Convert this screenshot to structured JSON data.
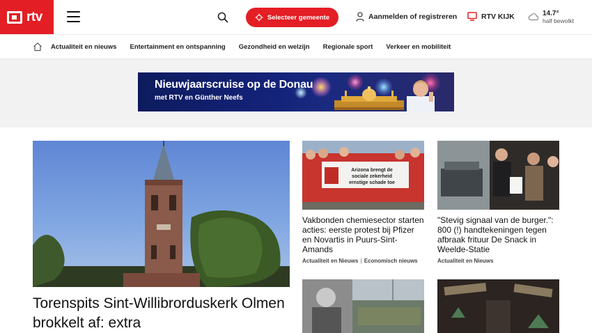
{
  "header": {
    "logo_text": "rtv",
    "select_button_label": "Selecteer gemeente",
    "login_label": "Aanmelden of registreren",
    "kijk_label": "RTV KIJK",
    "weather_temp": "14.7°",
    "weather_desc": "half bewolkt"
  },
  "subnav": {
    "items": [
      {
        "label": "Actualiteit en nieuws"
      },
      {
        "label": "Entertainment en ontspanning"
      },
      {
        "label": "Gezondheid en welzijn"
      },
      {
        "label": "Regionale sport"
      },
      {
        "label": "Verkeer en mobiliteit"
      }
    ]
  },
  "banner": {
    "title": "Nieuwjaarscruise op de Donau",
    "subtitle": "met RTV en Günther Neefs"
  },
  "main_article": {
    "title": "Torenspits Sint-Willibrorduskerk Olmen brokkelt af: extra"
  },
  "cards": [
    {
      "title": "Vakbonden chemiesector starten acties: eerste protest bij Pfizer en Novartis in Puurs-Sint-Amands",
      "tags": [
        "Actualiteit en Nieuws",
        "Economisch nieuws"
      ],
      "sign_lines": [
        "Arizona brengt de",
        "sociale zekerheid",
        "ernstige schade toe"
      ]
    },
    {
      "title": "\"Stevig signaal van de burger.\": 800 (!) handtekeningen tegen afbraak frituur De Snack in Weelde-Statie",
      "tags": [
        "Actualiteit en Nieuws"
      ]
    },
    {
      "title": "",
      "tags": []
    },
    {
      "title": "",
      "tags": []
    }
  ],
  "colors": {
    "brand_red": "#e31e24",
    "banner_blue": "#14237a"
  },
  "icons": [
    "hamburger-icon",
    "search-icon",
    "location-icon",
    "user-icon",
    "tv-icon",
    "cloud-icon",
    "home-icon"
  ]
}
